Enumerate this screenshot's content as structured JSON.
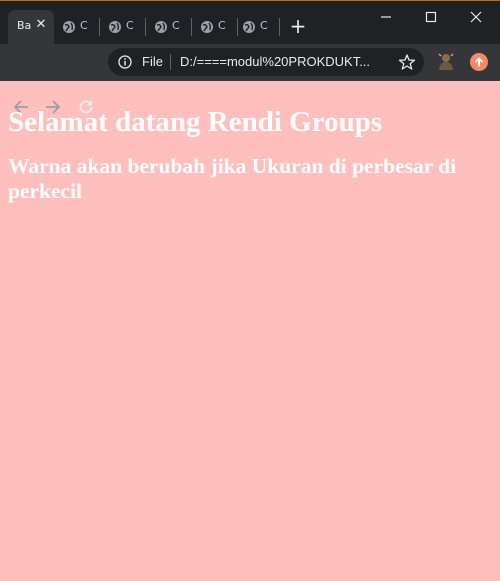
{
  "browser": {
    "active_tab": {
      "title": "Ba",
      "close_glyph": "✕"
    },
    "tabs": [
      {
        "title": "C",
        "icon": "globe-icon"
      },
      {
        "title": "C",
        "icon": "globe-icon"
      },
      {
        "title": "C",
        "icon": "globe-icon"
      },
      {
        "title": "C",
        "icon": "globe-icon"
      },
      {
        "title": "C",
        "icon": "globe-icon"
      }
    ],
    "new_tab_glyph": "+",
    "address": {
      "scheme_label": "File",
      "url": "D:/====modul%20PROKDUKT..."
    }
  },
  "page": {
    "heading": "Selamat datang Rendi Groups",
    "subheading": "Warna akan berubah jika Ukuran di perbesar di perkecil"
  },
  "colors": {
    "page_background": "#ffbfbd",
    "heading_text": "#ffffff",
    "chrome_dark": "#202124",
    "toolbar": "#35363a"
  }
}
